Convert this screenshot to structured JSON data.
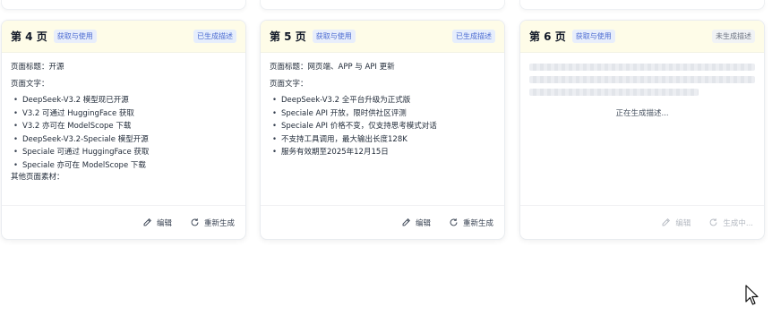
{
  "cards": [
    {
      "page_label": "第 4 页",
      "tag": "获取与使用",
      "status": "已生成描述",
      "title_line": "页面标题：开源",
      "text_heading": "页面文字：",
      "bullets": [
        "DeepSeek-V3.2 模型现已开源",
        "V3.2 可通过 HuggingFace 获取",
        "V3.2 亦可在 ModelScope 下载",
        "DeepSeek-V3.2-Speciale 模型开源",
        "Speciale 可通过 HuggingFace 获取",
        "Speciale 亦可在 ModelScope 下载"
      ],
      "other_line": "其他页面素材：",
      "edit_label": "编辑",
      "regen_label": "重新生成"
    },
    {
      "page_label": "第 5 页",
      "tag": "获取与使用",
      "status": "已生成描述",
      "title_line": "页面标题：网页端、APP 与 API 更新",
      "text_heading": "页面文字：",
      "bullets": [
        "DeepSeek-V3.2 全平台升级为正式版",
        "Speciale API 开放，限时供社区评测",
        "Speciale API 价格不变，仅支持思考模式对话",
        "不支持工具调用，最大输出长度128K",
        "服务有效期至2025年12月15日"
      ],
      "edit_label": "编辑",
      "regen_label": "重新生成"
    },
    {
      "page_label": "第 6 页",
      "tag": "获取与使用",
      "status": "未生成描述",
      "generating_text": "正在生成描述...",
      "edit_label": "编辑",
      "regen_label": "生成中..."
    }
  ],
  "icons": {
    "edit": "pencil-icon",
    "regen": "refresh-icon",
    "loading": "loading-icon",
    "cursor": "mouse-pointer-icon"
  },
  "colors": {
    "header_bg": "#fefce8",
    "tag_text": "#4b6bd1",
    "tag_bg": "#e8eefb",
    "pending_text": "#6b7280"
  }
}
